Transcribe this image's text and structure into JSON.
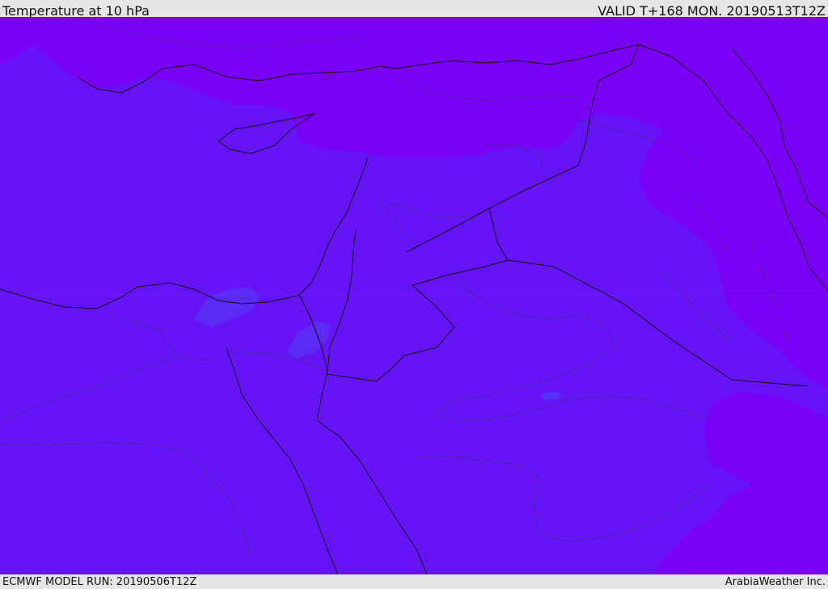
{
  "header": {
    "title": "Temperature at 10 hPa",
    "valid": "VALID T+168 MON. 20190513T12Z"
  },
  "footer": {
    "model_run": "ECMWF MODEL RUN: 20190506T12Z",
    "credit": "ArabiaWeather Inc."
  },
  "colors": {
    "cold_band": "#7a00f8",
    "mid_band": "#6614f7",
    "warm_band": "#5a2cf4",
    "warmest_patch": "#4f3ff2",
    "border_line": "#111111",
    "province_line": "#333333"
  }
}
